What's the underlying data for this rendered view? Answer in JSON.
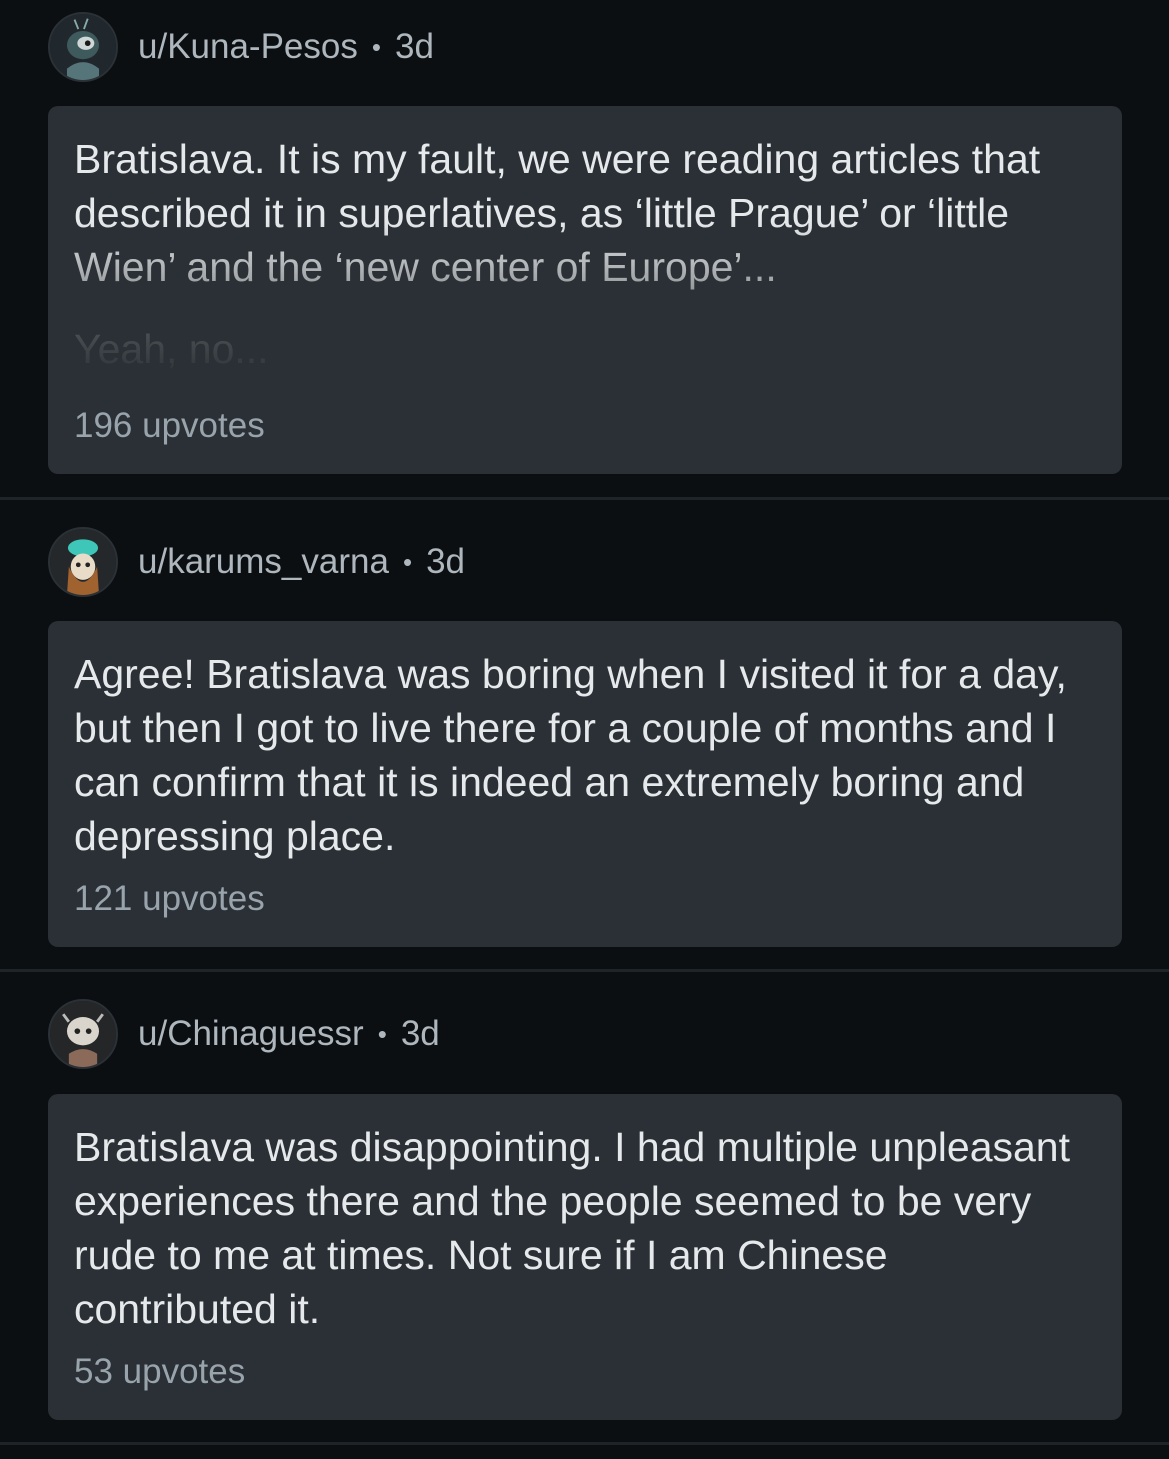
{
  "comments": [
    {
      "username": "u/Kuna-Pesos",
      "separator": "•",
      "age": "3d",
      "avatar_icon": "snoo-avatar-icon",
      "text": "Bratislava. It is my fault, we were reading articles that described it in superlatives, as ‘little Prague’ or ‘little Wien’ and the ‘new center of Europe’...",
      "faded_text": "Yeah, no...",
      "upvotes": "196 upvotes"
    },
    {
      "username": "u/karums_varna",
      "separator": "•",
      "age": "3d",
      "avatar_icon": "snoo-avatar-icon",
      "text": "Agree! Bratislava was boring when I visited it for a day, but then I got to live there for a couple of months and I can confirm that it is indeed an extremely boring and depressing place.",
      "upvotes": "121 upvotes"
    },
    {
      "username": "u/Chinaguessr",
      "separator": "•",
      "age": "3d",
      "avatar_icon": "snoo-avatar-icon",
      "text": "Bratislava was disappointing. I had multiple unpleasant experiences there and the people seemed to be very rude to me at times. Not sure if I am Chinese contributed it.",
      "upvotes": "53 upvotes"
    }
  ],
  "colors": {
    "background": "#0c0f12",
    "card": "#2a3035",
    "username": "#aeb7bd",
    "body_text": "#e6e9eb",
    "upvotes": "#98a3ab"
  }
}
